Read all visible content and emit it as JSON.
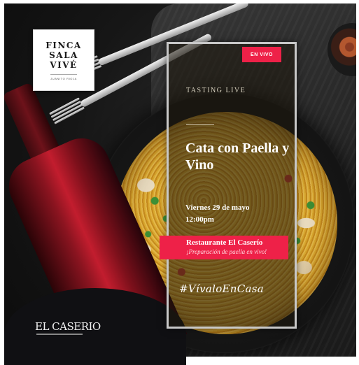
{
  "logo": {
    "lines": [
      "FINCA",
      "SALA",
      "VIVÉ"
    ],
    "sub": "JUANITO RIOJA"
  },
  "badge": "EN VIVO",
  "tasting_label": "TASTING LIVE",
  "headline": "Cata con Paella y Vino",
  "date_line": "Viernes 29 de mayo",
  "time_line": "12:00pm",
  "venue": "Restaurante El Caserío",
  "venue_note": "¡Preparación de paella en vivo!",
  "hashtag": "#VívaloEnCasa",
  "brand_logo": "EL CASERIO",
  "colors": {
    "accent": "#ee2148",
    "panel_border": "#c8c8c8",
    "rice": "#c89226"
  }
}
